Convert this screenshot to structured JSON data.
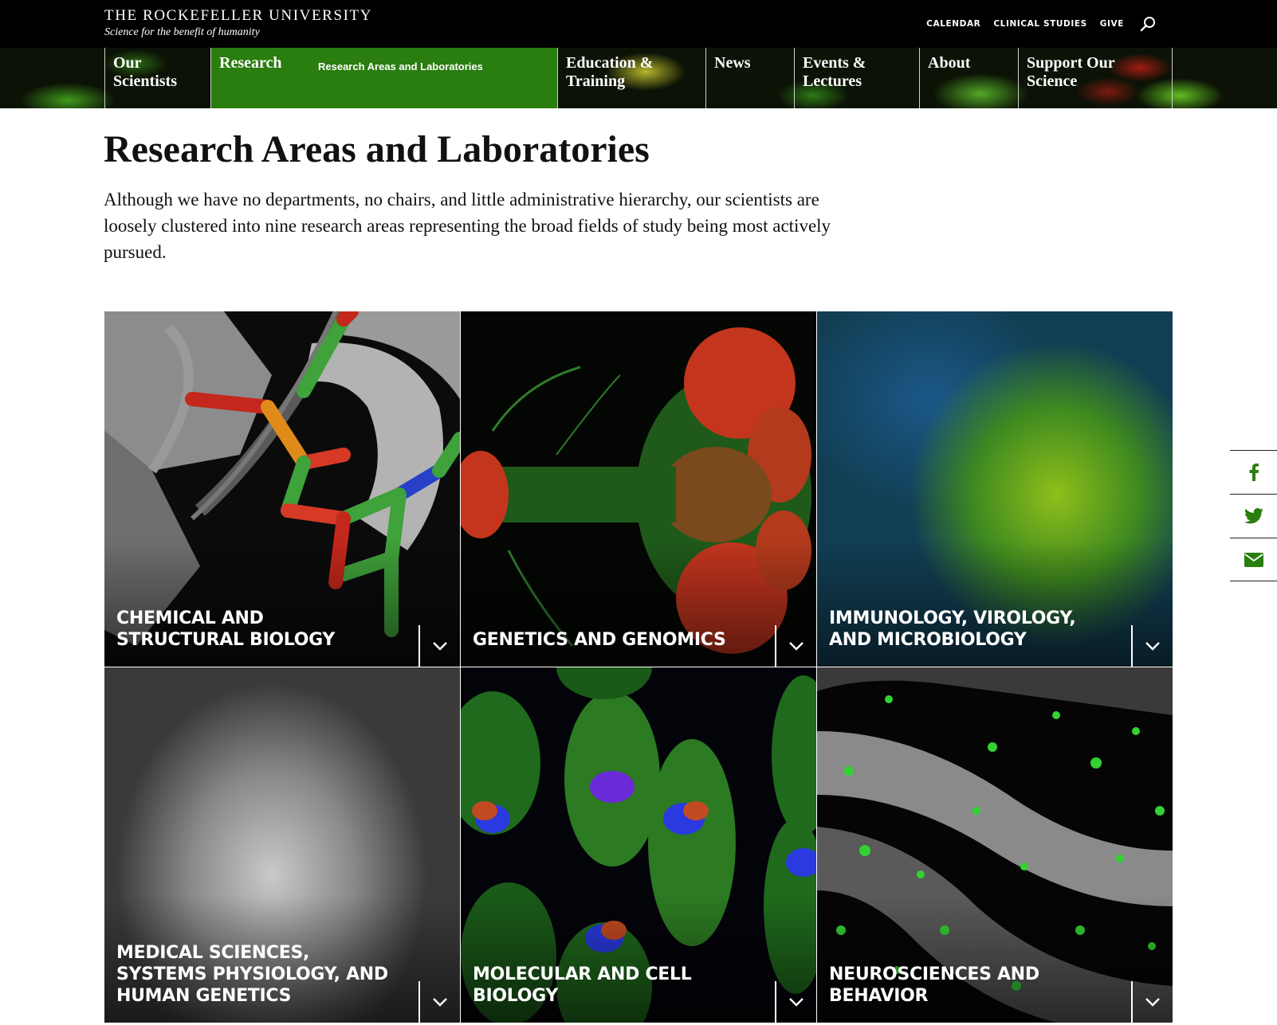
{
  "header": {
    "brand_name": "THE ROCKEFELLER UNIVERSITY",
    "tagline": "Science for the benefit of humanity",
    "utility_links": [
      "CALENDAR",
      "CLINICAL STUDIES",
      "GIVE"
    ],
    "search_icon": "search-icon"
  },
  "nav": {
    "items": [
      {
        "label": "Our Scientists"
      },
      {
        "label": "Research"
      },
      {
        "label": "Education & Training"
      },
      {
        "label": "News"
      },
      {
        "label": "Events & Lectures"
      },
      {
        "label": "About"
      },
      {
        "label": "Support Our Science"
      }
    ],
    "active_sub_label": "Research Areas and Laboratories"
  },
  "page": {
    "title": "Research Areas and Laboratories",
    "intro": "Although we have no departments, no chairs, and little administrative hierarchy, our scientists are loosely clustered into nine research areas representing the broad fields of study being most actively pursued."
  },
  "research_areas": [
    {
      "title": "Chemical and Structural Biology"
    },
    {
      "title": "Genetics and Genomics"
    },
    {
      "title": "Immunology, Virology, and Microbiology"
    },
    {
      "title": "Medical Sciences, Systems Physiology, and Human Genetics"
    },
    {
      "title": "Molecular and Cell Biology"
    },
    {
      "title": "Neurosciences and Behavior"
    }
  ],
  "share": {
    "icons": [
      "facebook-icon",
      "twitter-icon",
      "email-icon"
    ]
  },
  "colors": {
    "nav_active": "#2a7d0f",
    "share_icon": "#2a7d0f",
    "topbar": "#000000"
  }
}
